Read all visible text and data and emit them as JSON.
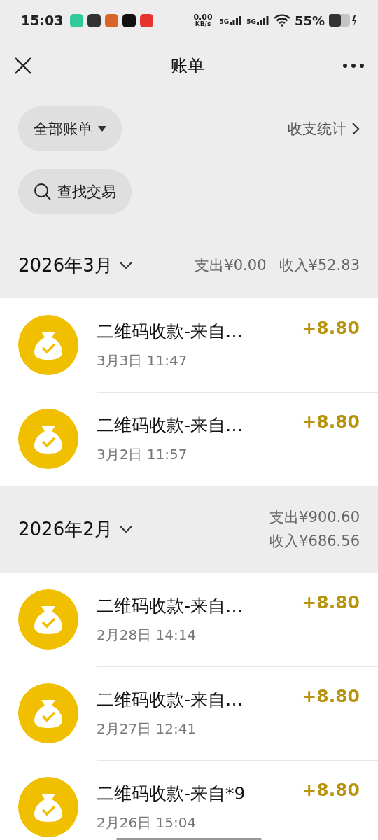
{
  "status_bar": {
    "time": "15:03",
    "app_icons": [
      {
        "color": "#2fc99a"
      },
      {
        "color": "#333333"
      },
      {
        "color": "#d9642a"
      },
      {
        "color": "#111111"
      },
      {
        "color": "#e5332f"
      }
    ],
    "net_speed": "0.00",
    "net_unit": "KB/s",
    "signals": [
      "5G",
      "5G"
    ],
    "battery": "55%"
  },
  "nav": {
    "title": "账单"
  },
  "filter": {
    "label": "全部账单",
    "stats_link": "收支统计"
  },
  "search": {
    "label": "查找交易"
  },
  "months": [
    {
      "title": "2026年3月",
      "summary": [
        "支出¥0.00",
        "收入¥52.83"
      ],
      "stacked": false,
      "transactions": [
        {
          "title": "二维码收款-来自…",
          "time": "3月3日 11:47",
          "amount": "+8.80"
        },
        {
          "title": "二维码收款-来自…",
          "time": "3月2日 11:57",
          "amount": "+8.80"
        }
      ]
    },
    {
      "title": "2026年2月",
      "summary": [
        "支出¥900.60",
        "收入¥686.56"
      ],
      "stacked": true,
      "transactions": [
        {
          "title": "二维码收款-来自…",
          "time": "2月28日 14:14",
          "amount": "+8.80"
        },
        {
          "title": "二维码收款-来自…",
          "time": "2月27日 12:41",
          "amount": "+8.80"
        },
        {
          "title": "二维码收款-来自*9",
          "time": "2月26日 15:04",
          "amount": "+8.80"
        }
      ]
    }
  ]
}
